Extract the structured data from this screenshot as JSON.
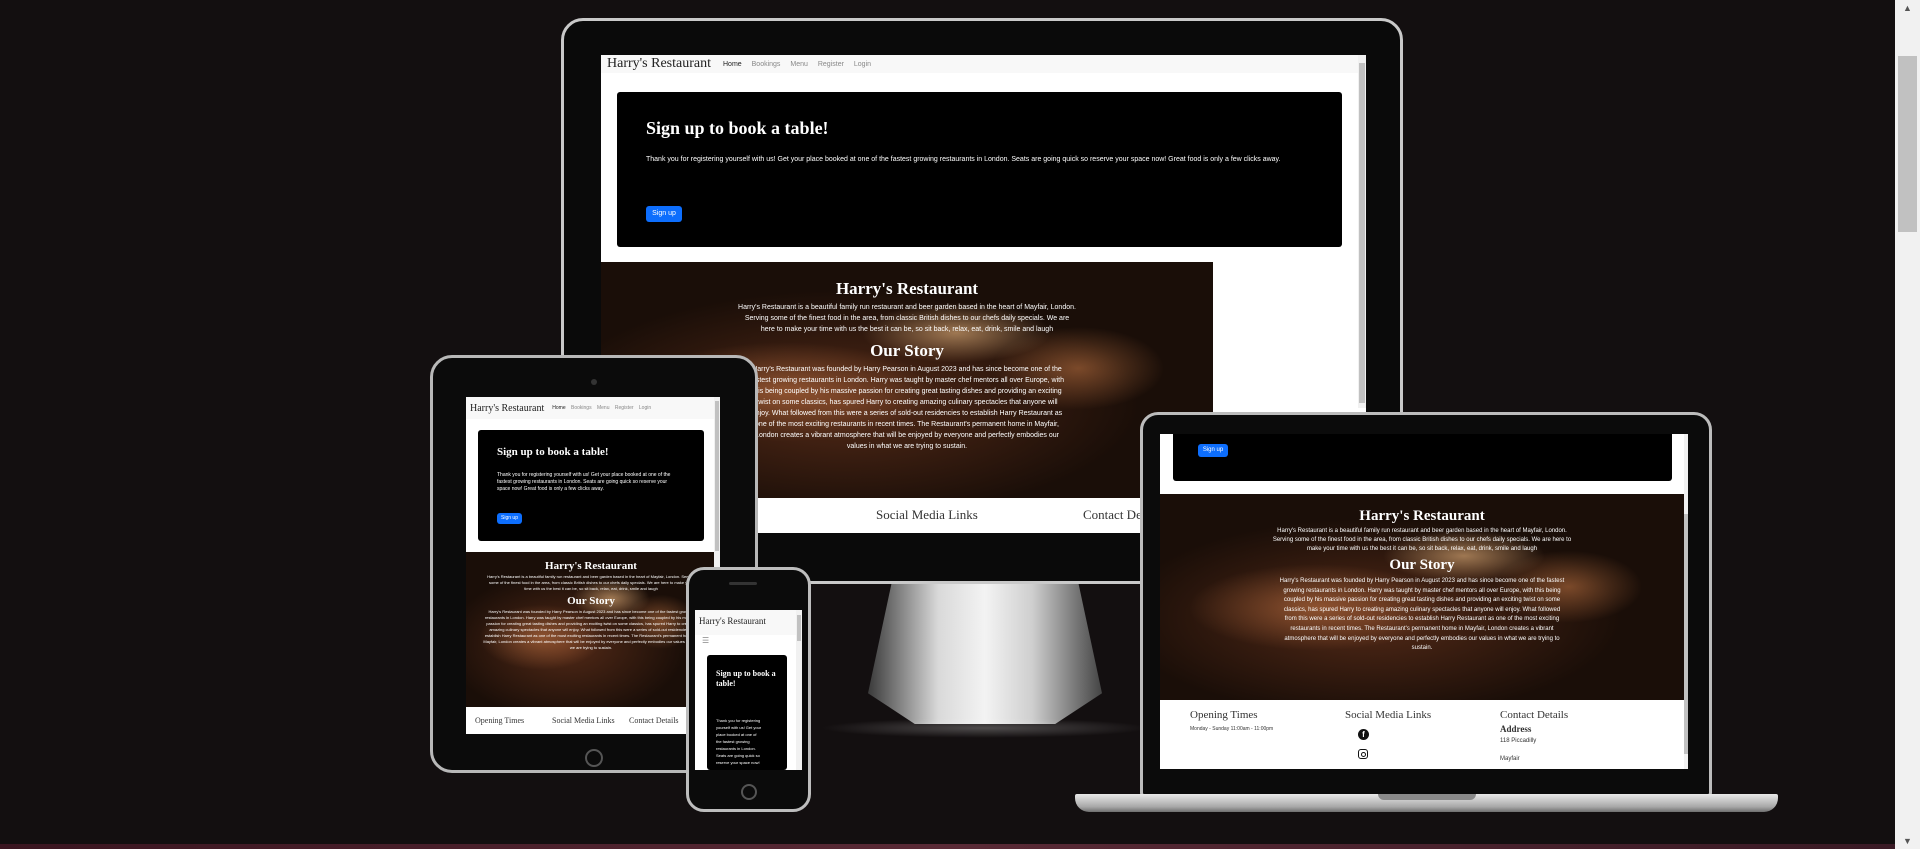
{
  "site": {
    "brand": "Harry's Restaurant",
    "nav": [
      "Home",
      "Bookings",
      "Menu",
      "Register",
      "Login"
    ],
    "signup": {
      "heading": "Sign up to book a table!",
      "text": "Thank you for registering yourself with us! Get your place booked at one of the fastest growing restaurants in London. Seats are going quick so reserve your space now! Great food is only a few clicks away.",
      "button": "Sign up"
    },
    "about": {
      "heading": "Harry's Restaurant",
      "text": "Harry's Restaurant is a beautiful family run restaurant and beer garden based in the heart of Mayfair, London. Serving some of the finest food in the area, from classic British dishes to our chefs daily specials. We are here to make your time with us the best it can be, so sit back, relax, eat, drink, smile and laugh"
    },
    "story": {
      "heading": "Our Story",
      "text": "Harry's Restaurant was founded by Harry Pearson in August 2023 and has since become one of the fastest growing restaurants in London. Harry was taught by master chef mentors all over Europe, with this being coupled by his massive passion for creating great tasting dishes and providing an exciting twist on some classics, has spured Harry to creating amazing culinary spectacles that anyone will enjoy. What followed from this were a series of sold-out residencies to establish Harry Restaurant as one of the most exciting restaurants in recent times. The Restaurant's permanent home in Mayfair, London creates a vibrant atmosphere that will be enjoyed by everyone and perfectly embodies our values in what we are trying to sustain."
    },
    "footer": {
      "opening_title": "Opening Times",
      "opening_hours": "Monday - Sunday 11:00am - 11:00pm",
      "social_title": "Social Media Links",
      "contact_title": "Contact Details",
      "address_title": "Address",
      "address_line1": "118 Piccadilly",
      "address_line2": "Mayfair"
    }
  },
  "colors": {
    "page_bg": "#130f10",
    "button_blue": "#0d6efd",
    "hero_black": "#000000"
  },
  "icons": [
    "facebook-icon",
    "instagram-icon",
    "hamburger-menu-icon",
    "scroll-up-arrow-icon",
    "scroll-down-arrow-icon"
  ]
}
